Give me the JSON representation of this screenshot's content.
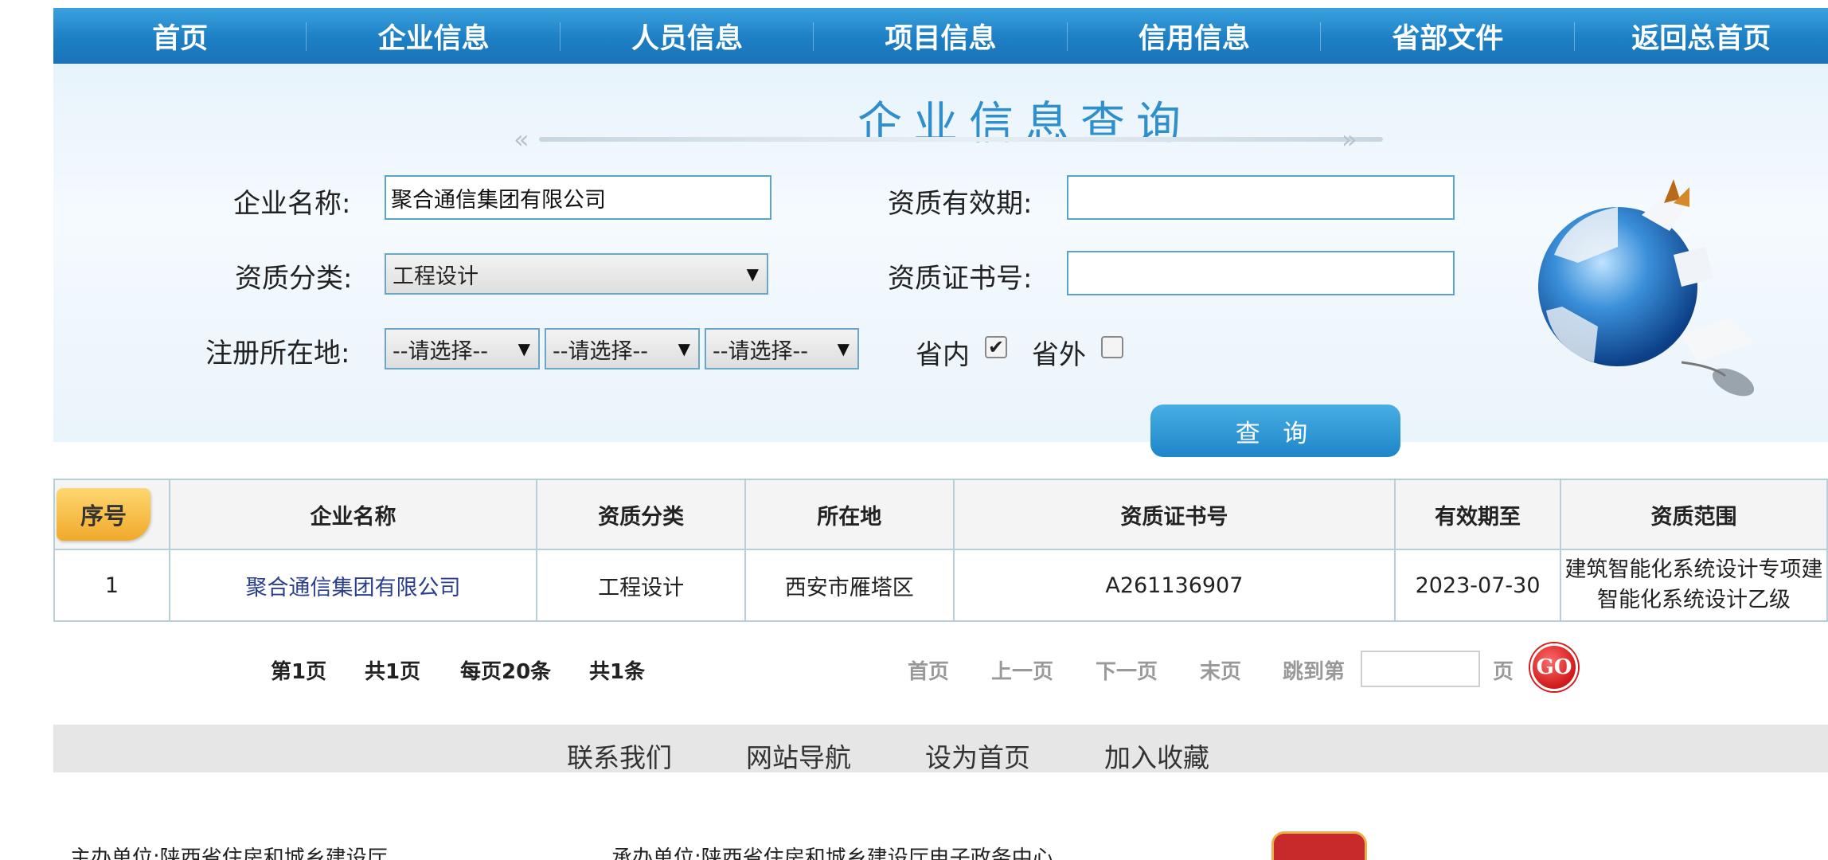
{
  "nav": [
    "首页",
    "企业信息",
    "人员信息",
    "项目信息",
    "信用信息",
    "省部文件",
    "返回总首页"
  ],
  "search": {
    "title": "企业信息查询",
    "company_name_label": "企业名称:",
    "company_name_value": "聚合通信集团有限公司",
    "validity_label": "资质有效期:",
    "validity_value": "",
    "category_label": "资质分类:",
    "category_value": "工程设计",
    "cert_label": "资质证书号:",
    "cert_value": "",
    "location_label": "注册所在地:",
    "location_selects": [
      "--请选择--",
      "--请选择--",
      "--请选择--"
    ],
    "in_province_label": "省内",
    "in_province_checked": true,
    "out_province_label": "省外",
    "out_province_checked": false,
    "query_button": "查 询"
  },
  "table": {
    "seq_header": "序号",
    "headers": [
      "企业名称",
      "资质分类",
      "所在地",
      "资质证书号",
      "有效期至",
      "资质范围"
    ],
    "rows": [
      {
        "seq": "1",
        "name": "聚合通信集团有限公司",
        "category": "工程设计",
        "location": "西安市雁塔区",
        "cert": "A261136907",
        "expiry": "2023-07-30",
        "scope_line1": "建筑智能化系统设计专项建",
        "scope_line2": "智能化系统设计乙级"
      }
    ]
  },
  "pager": {
    "page": "第1页",
    "total_pages": "共1页",
    "per_page": "每页20条",
    "total": "共1条",
    "first": "首页",
    "prev": "上一页",
    "next": "下一页",
    "last": "末页",
    "jump_label": "跳到第",
    "page_unit": "页",
    "go": "GO"
  },
  "footer": {
    "links": [
      "联系我们",
      "网站导航",
      "设为首页",
      "加入收藏"
    ],
    "host": "主办单位:陕西省住房和城乡建设厅",
    "operator": "承办单位:陕西省住房和城乡建设厅电子政务中心"
  },
  "colors": {
    "nav": "#1d7fc4",
    "title": "#2f8fcc",
    "button": "#2a8fd0",
    "go": "#d01a1a"
  }
}
